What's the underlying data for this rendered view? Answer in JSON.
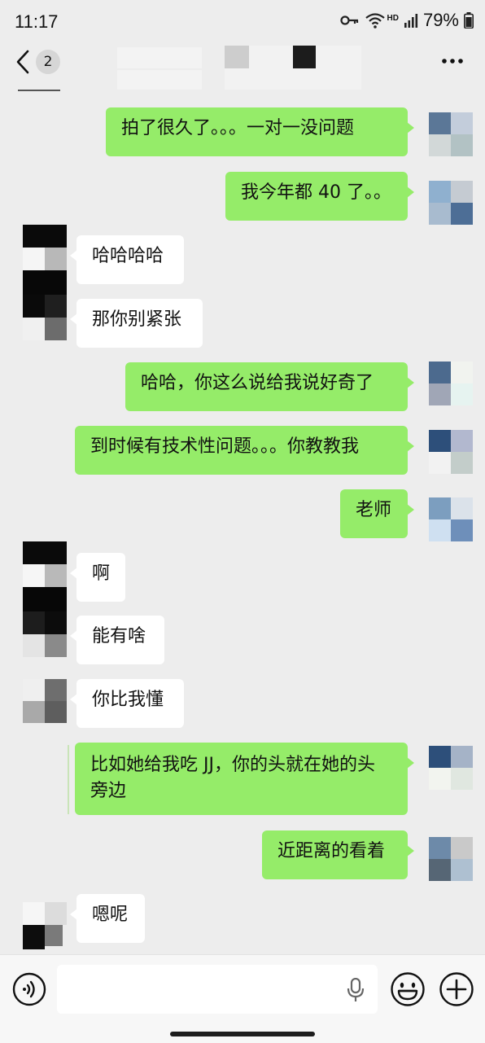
{
  "status_bar": {
    "time": "11:17",
    "network": "HD",
    "battery": "79%"
  },
  "nav": {
    "unread_count": "2"
  },
  "messages": [
    {
      "text": "拍了很久了。。。一对一没问题"
    },
    {
      "text": "我今年都 40 了。。"
    },
    {
      "text": "哈哈哈哈"
    },
    {
      "text": "那你别紧张"
    },
    {
      "text": "哈哈，你这么说给我说好奇了"
    },
    {
      "text": "到时候有技术性问题。。。你教教我"
    },
    {
      "text": "老师"
    },
    {
      "text": "啊"
    },
    {
      "text": "能有啥"
    },
    {
      "text": "你比我懂"
    },
    {
      "text": "比如她给我吃 JJ，你的头就在她的头旁边"
    },
    {
      "text": "近距离的看着"
    },
    {
      "text": "嗯呢"
    }
  ],
  "input": {
    "placeholder": ""
  },
  "colors": {
    "sent_bubble": "#95ec69",
    "received_bubble": "#ffffff",
    "background": "#ededed"
  },
  "icons": [
    "back-icon",
    "more-icon",
    "voice-icon",
    "mic-icon",
    "emoji-icon",
    "plus-icon",
    "wifi-icon",
    "signal-icon",
    "battery-icon",
    "key-icon"
  ]
}
